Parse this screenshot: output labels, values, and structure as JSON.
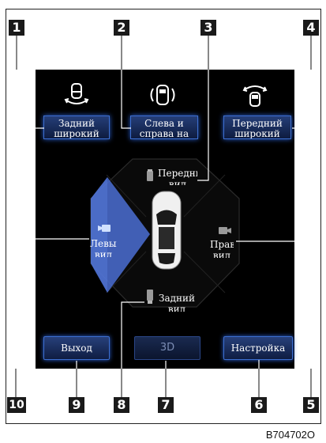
{
  "callouts": [
    "1",
    "2",
    "3",
    "4",
    "5",
    "6",
    "7",
    "8",
    "9",
    "10"
  ],
  "modes": [
    {
      "label": "Задний широкий",
      "icon": "rear-wide-view-icon"
    },
    {
      "label": "Слева и справа на",
      "icon": "side-view-icon"
    },
    {
      "label": "Передний широкий",
      "icon": "front-wide-view-icon"
    }
  ],
  "views": {
    "front": "Передний вид",
    "left": "Левый вид",
    "right": "Правый вид",
    "rear": "Задний вид"
  },
  "buttons": {
    "exit": "Выход",
    "three_d": "3D",
    "settings": "Настройка"
  },
  "figure_code": "B704702O",
  "colors": {
    "accent": "#3d6fd0",
    "selected_view": "#4b6fd4",
    "screen": "#000000"
  }
}
